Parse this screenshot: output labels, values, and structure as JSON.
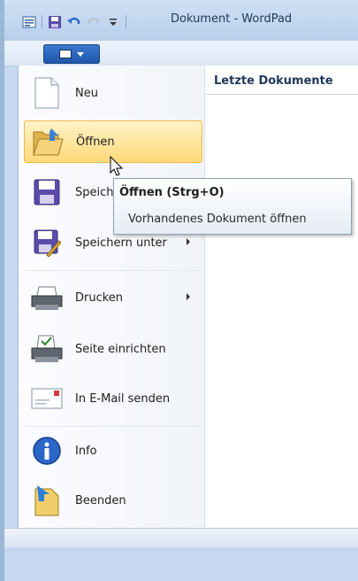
{
  "window": {
    "title": "Dokument - WordPad"
  },
  "menu": {
    "recent_title": "Letzte Dokumente",
    "items": [
      {
        "label": "Neu",
        "icon": "new-document-icon"
      },
      {
        "label": "Öffnen",
        "icon": "open-folder-icon"
      },
      {
        "label": "Speichern",
        "icon": "save-disk-icon"
      },
      {
        "label": "Speichern unter",
        "icon": "save-as-icon"
      },
      {
        "label": "Drucken",
        "icon": "printer-icon"
      },
      {
        "label": "Seite einrichten",
        "icon": "page-setup-icon"
      },
      {
        "label": "In E-Mail senden",
        "icon": "email-icon"
      },
      {
        "label": "Info",
        "icon": "info-icon"
      },
      {
        "label": "Beenden",
        "icon": "exit-icon"
      }
    ]
  },
  "tooltip": {
    "title": "Öffnen (Strg+O)",
    "description": "Vorhandenes Dokument öffnen"
  },
  "colors": {
    "selection_border": "#f0b84c",
    "selection_fill": "#ffd979",
    "app_button": "#2a62b8"
  }
}
